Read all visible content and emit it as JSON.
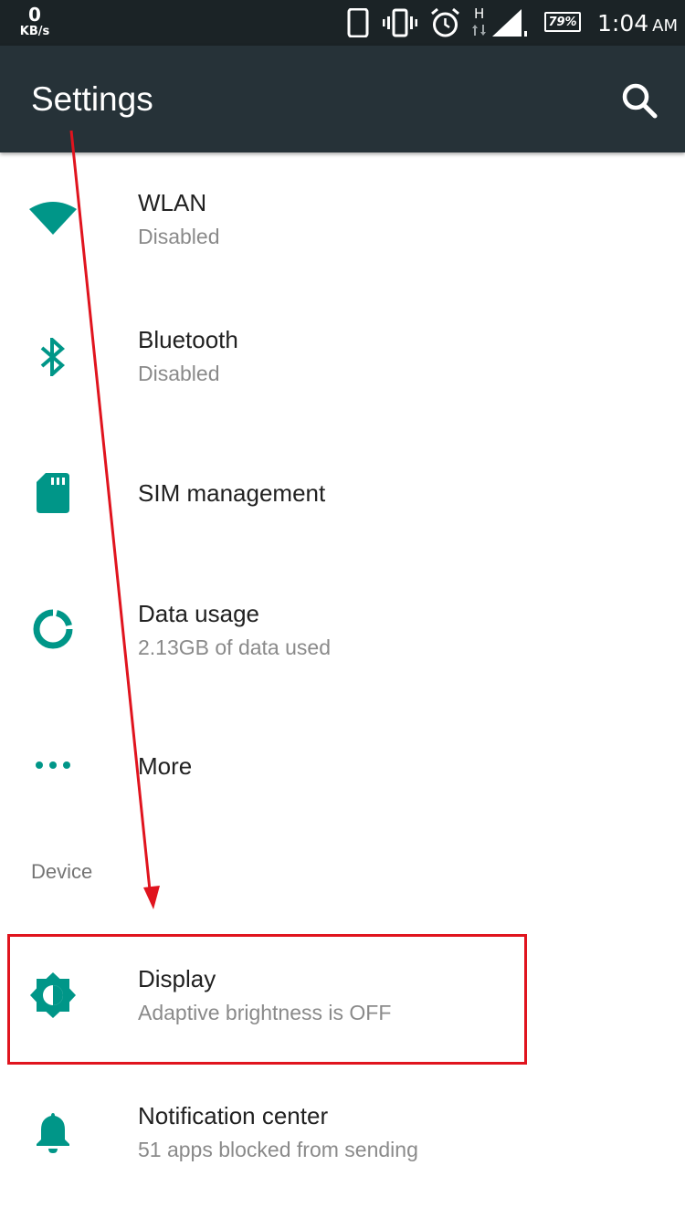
{
  "status_bar": {
    "speed_value": "0",
    "speed_unit": "KB/s",
    "network_type": "H",
    "battery": "79%",
    "time": "1:04",
    "ampm": "AM",
    "icons": [
      "phone-outline-icon",
      "vibrate-icon",
      "alarm-icon",
      "signal-icon",
      "battery-icon"
    ]
  },
  "app_bar": {
    "title": "Settings",
    "search_icon": "search-icon"
  },
  "settings": {
    "items": [
      {
        "title": "WLAN",
        "subtitle": "Disabled",
        "icon": "wifi-icon"
      },
      {
        "title": "Bluetooth",
        "subtitle": "Disabled",
        "icon": "bluetooth-icon"
      },
      {
        "title": "SIM management",
        "subtitle": "",
        "icon": "sim-card-icon"
      },
      {
        "title": "Data usage",
        "subtitle": "2.13GB of data used",
        "icon": "data-usage-icon"
      },
      {
        "title": "More",
        "subtitle": "",
        "icon": "more-dots-icon"
      }
    ],
    "device_header": "Device",
    "device_items": [
      {
        "title": "Display",
        "subtitle": "Adaptive brightness is OFF",
        "icon": "brightness-icon"
      },
      {
        "title": "Notification center",
        "subtitle": "51 apps blocked from sending",
        "icon": "bell-icon"
      }
    ]
  },
  "colors": {
    "accent": "#009688",
    "status_bar": "#1b2326",
    "app_bar": "#263238",
    "annotation": "#e0141e"
  }
}
